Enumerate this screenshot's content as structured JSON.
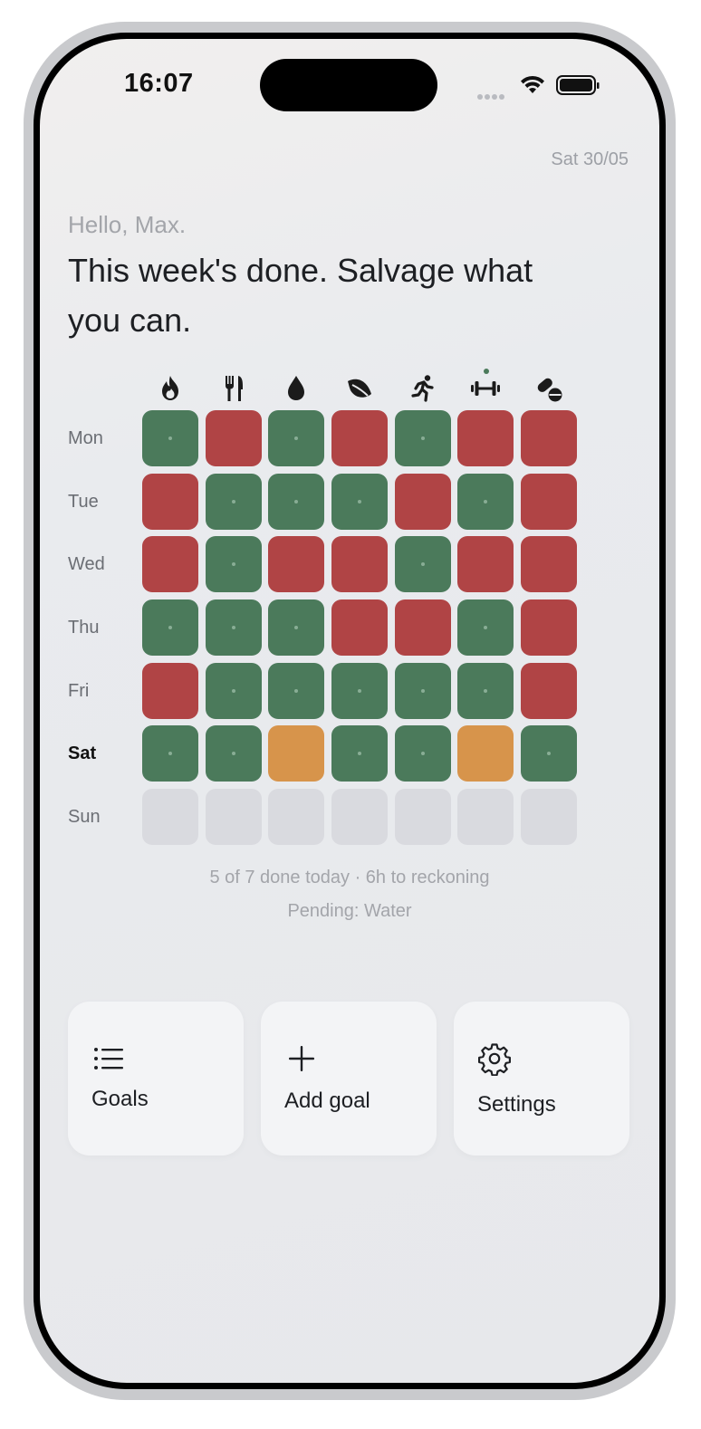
{
  "status_bar": {
    "time": "16:07"
  },
  "header": {
    "date": "Sat 30/05",
    "greeting": "Hello, Max.",
    "headline": "This week's done. Salvage what you can."
  },
  "goals": [
    {
      "icon": "flame-icon",
      "active": false
    },
    {
      "icon": "fork-knife-icon",
      "active": false
    },
    {
      "icon": "water-drop-icon",
      "active": false
    },
    {
      "icon": "leaf-icon",
      "active": false
    },
    {
      "icon": "running-person-icon",
      "active": false
    },
    {
      "icon": "dumbbell-icon",
      "active": true
    },
    {
      "icon": "pills-icon",
      "active": false
    }
  ],
  "days": [
    {
      "label": "Mon",
      "today": false,
      "cells": [
        "done",
        "miss",
        "done",
        "miss",
        "done",
        "miss",
        "miss"
      ]
    },
    {
      "label": "Tue",
      "today": false,
      "cells": [
        "miss",
        "done",
        "done",
        "done",
        "miss",
        "done",
        "miss"
      ]
    },
    {
      "label": "Wed",
      "today": false,
      "cells": [
        "miss",
        "done",
        "miss",
        "miss",
        "done",
        "miss",
        "miss"
      ]
    },
    {
      "label": "Thu",
      "today": false,
      "cells": [
        "done",
        "done",
        "done",
        "miss",
        "miss",
        "done",
        "miss"
      ]
    },
    {
      "label": "Fri",
      "today": false,
      "cells": [
        "miss",
        "done",
        "done",
        "done",
        "done",
        "done",
        "miss"
      ]
    },
    {
      "label": "Sat",
      "today": true,
      "cells": [
        "done",
        "done",
        "pend",
        "done",
        "done",
        "pend",
        "done"
      ]
    },
    {
      "label": "Sun",
      "today": false,
      "cells": [
        "empty",
        "empty",
        "empty",
        "empty",
        "empty",
        "empty",
        "empty"
      ]
    }
  ],
  "summary": {
    "progress": "5 of 7 done today · 6h to reckoning",
    "pending": "Pending: Water"
  },
  "actions": {
    "goals_label": "Goals",
    "add_goal_label": "Add goal",
    "settings_label": "Settings"
  },
  "colors": {
    "done": "#4b7a5b",
    "miss": "#b04445",
    "pending": "#d7944b",
    "empty": "#d9dadf"
  }
}
